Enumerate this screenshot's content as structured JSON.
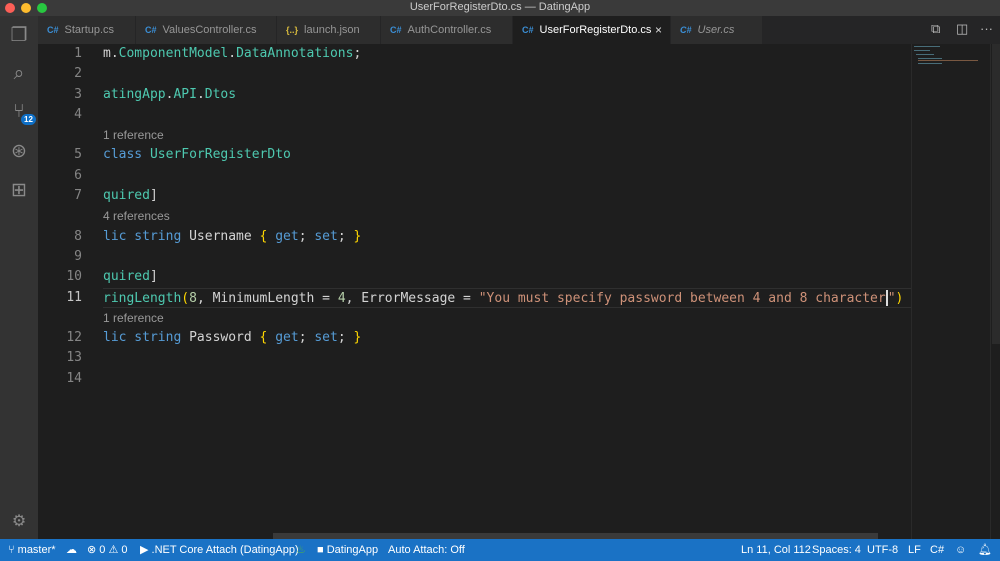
{
  "window": {
    "title": "UserForRegisterDto.cs — DatingApp"
  },
  "activity_bar": {
    "scm_badge": "12",
    "icons": [
      "files-icon",
      "search-icon",
      "source-control-icon",
      "debug-icon",
      "extensions-icon",
      "gear-icon"
    ]
  },
  "tabs": [
    {
      "label": "Startup.cs",
      "icon": "C#"
    },
    {
      "label": "ValuesController.cs",
      "icon": "C#"
    },
    {
      "label": "launch.json",
      "icon": "{..}"
    },
    {
      "label": "AuthController.cs",
      "icon": "C#"
    },
    {
      "label": "UserForRegisterDto.cs",
      "icon": "C#",
      "active": true,
      "close": "×"
    },
    {
      "label": "User.cs",
      "icon": "C#",
      "italic": true
    }
  ],
  "tab_actions": {
    "open_changes": "⧉",
    "split": "◫",
    "more": "···"
  },
  "editor": {
    "rows": [
      {
        "ln": "1",
        "tokens": [
          [
            "t-def",
            "m."
          ],
          [
            "t-type",
            "ComponentModel"
          ],
          [
            "t-def",
            "."
          ],
          [
            "t-type",
            "DataAnnotations"
          ],
          [
            "t-def",
            ";"
          ]
        ]
      },
      {
        "ln": "2",
        "tokens": []
      },
      {
        "ln": "3",
        "tokens": [
          [
            "t-type",
            "atingApp"
          ],
          [
            "t-def",
            "."
          ],
          [
            "t-type",
            "API"
          ],
          [
            "t-def",
            "."
          ],
          [
            "t-type",
            "Dtos"
          ]
        ]
      },
      {
        "ln": "4",
        "tokens": []
      },
      {
        "lens": "1 reference"
      },
      {
        "ln": "5",
        "tokens": [
          [
            "t-kw",
            "class "
          ],
          [
            "t-type",
            "UserForRegisterDto"
          ]
        ]
      },
      {
        "ln": "6",
        "tokens": []
      },
      {
        "ln": "7",
        "tokens": [
          [
            "t-type",
            "quired"
          ],
          [
            "t-def",
            "]"
          ]
        ]
      },
      {
        "lens": "4 references"
      },
      {
        "ln": "8",
        "tokens": [
          [
            "t-kw",
            "lic string "
          ],
          [
            "t-def",
            "Username "
          ],
          [
            "t-br",
            "{ "
          ],
          [
            "t-kw",
            "get"
          ],
          [
            "t-def",
            "; "
          ],
          [
            "t-kw",
            "set"
          ],
          [
            "t-def",
            "; "
          ],
          [
            "t-br",
            "}"
          ]
        ]
      },
      {
        "ln": "9",
        "tokens": []
      },
      {
        "ln": "10",
        "tokens": [
          [
            "t-type",
            "quired"
          ],
          [
            "t-def",
            "]"
          ]
        ]
      },
      {
        "ln": "11",
        "current": true,
        "tokens": [
          [
            "t-type",
            "ringLength"
          ],
          [
            "t-br",
            "("
          ],
          [
            "t-num",
            "8"
          ],
          [
            "t-def",
            ", MinimumLength = "
          ],
          [
            "t-num",
            "4"
          ],
          [
            "t-def",
            ", ErrorMessage = "
          ],
          [
            "t-str",
            "\"You must specify password between 4 and 8 character"
          ],
          [
            "caret",
            ""
          ],
          [
            "t-str",
            "\""
          ],
          [
            "t-br",
            ")"
          ]
        ]
      },
      {
        "lens": "1 reference"
      },
      {
        "ln": "12",
        "tokens": [
          [
            "t-kw",
            "lic string "
          ],
          [
            "t-def",
            "Password "
          ],
          [
            "t-br",
            "{ "
          ],
          [
            "t-kw",
            "get"
          ],
          [
            "t-def",
            "; "
          ],
          [
            "t-kw",
            "set"
          ],
          [
            "t-def",
            "; "
          ],
          [
            "t-br",
            "}"
          ]
        ]
      },
      {
        "ln": "13",
        "tokens": []
      },
      {
        "ln": "14",
        "tokens": []
      }
    ]
  },
  "status": {
    "branch": "master*",
    "sync": "☁",
    "errors": "0",
    "warnings": "0",
    "debug": ".NET Core Attach (DatingApp)",
    "project": "DatingApp",
    "auto_attach": "Auto Attach: Off",
    "position": "Ln 11, Col 112",
    "spaces": "Spaces: 4",
    "encoding": "UTF-8",
    "eol": "LF",
    "language": "C#"
  },
  "colors": {
    "status_bar": "#1a72c5",
    "type": "#4ec9b0",
    "keyword": "#569cd6",
    "string": "#ce9178",
    "number": "#b5cea8"
  }
}
